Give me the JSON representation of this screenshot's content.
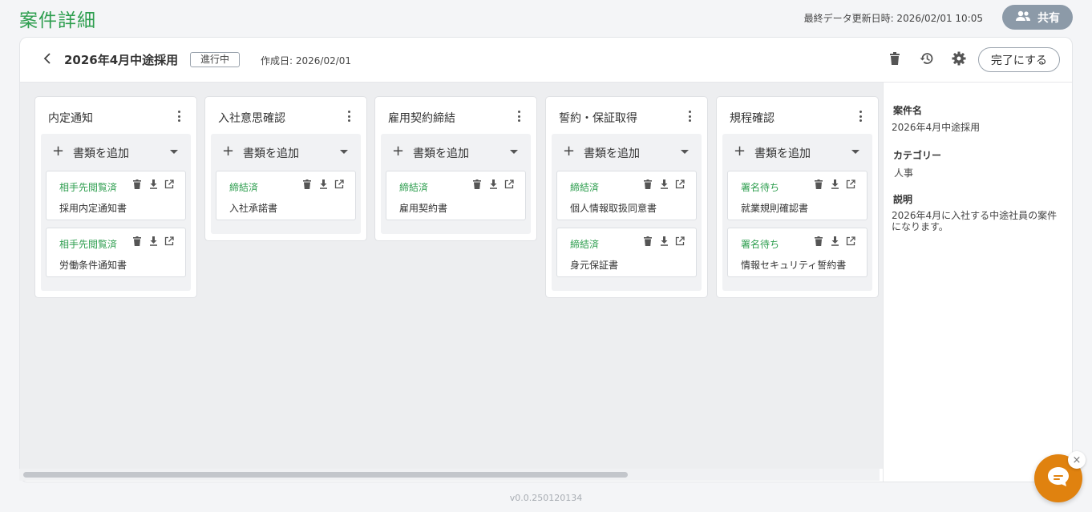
{
  "header": {
    "title": "案件詳細",
    "last_updated": "最終データ更新日時: 2026/02/01 10:05",
    "share_label": "共有"
  },
  "project": {
    "name": "2026年4月中途採用",
    "status": "進行中",
    "created": "作成日: 2026/02/01",
    "complete_label": "完了にする",
    "icons": [
      "trash-icon",
      "history-icon",
      "gear-icon"
    ]
  },
  "board": {
    "add_label": "書類を追加",
    "add_symbol": "+",
    "columns": [
      {
        "title": "内定通知",
        "docs": [
          {
            "status": "相手先閲覧済",
            "name": "採用内定通知書"
          },
          {
            "status": "相手先閲覧済",
            "name": "労働条件通知書"
          }
        ]
      },
      {
        "title": "入社意思確認",
        "docs": [
          {
            "status": "締結済",
            "name": "入社承諾書"
          }
        ]
      },
      {
        "title": "雇用契約締結",
        "docs": [
          {
            "status": "締結済",
            "name": "雇用契約書"
          }
        ]
      },
      {
        "title": "誓約・保証取得",
        "docs": [
          {
            "status": "締結済",
            "name": "個人情報取扱同意書"
          },
          {
            "status": "締結済",
            "name": "身元保証書"
          }
        ]
      },
      {
        "title": "規程確認",
        "docs": [
          {
            "status": "署名待ち",
            "name": "就業規則確認書"
          },
          {
            "status": "署名待ち",
            "name": "情報セキュリティ誓約書"
          }
        ]
      }
    ]
  },
  "side": {
    "name_label": "案件名",
    "name_value": "2026年4月中途採用",
    "category_label": "カテゴリー",
    "category_value": "人事",
    "description_label": "説明",
    "description_value": "2026年4月に入社する中途社員の案件になります。"
  },
  "footer": {
    "version": "v0.0.250120134"
  },
  "chat": {
    "close_symbol": "×"
  },
  "colors": {
    "accent": "#2e9e4f",
    "share_button": "#8c9aa8",
    "chat_button": "#e0820f"
  }
}
